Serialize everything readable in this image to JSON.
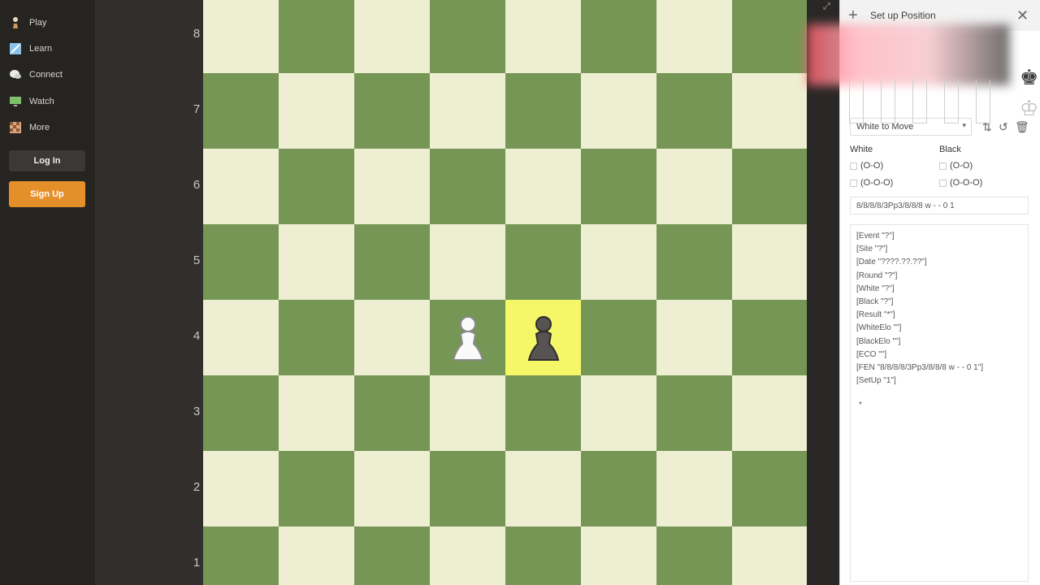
{
  "nav": {
    "items": [
      {
        "label": "Play",
        "icon": "pawn-icon"
      },
      {
        "label": "Learn",
        "icon": "puzzle-icon"
      },
      {
        "label": "Connect",
        "icon": "chat-icon"
      },
      {
        "label": "Watch",
        "icon": "monitor-icon"
      },
      {
        "label": "More",
        "icon": "grid-icon"
      }
    ],
    "login_label": "Log In",
    "signup_label": "Sign Up"
  },
  "board": {
    "ranks": [
      "8",
      "7",
      "6",
      "5",
      "4",
      "3",
      "2",
      "1"
    ],
    "colors": {
      "light": "#eeeed2",
      "dark": "#769656",
      "highlight": "#f6f669"
    },
    "pieces": [
      {
        "square": "d4",
        "piece": "white-pawn",
        "glyph": "♙"
      },
      {
        "square": "e4",
        "piece": "black-pawn",
        "glyph": "♟"
      }
    ],
    "highlighted_square": "e4"
  },
  "panel": {
    "title": "Set up Position",
    "side_to_move": "White to Move",
    "white_label": "White",
    "black_label": "Black",
    "white_options": [
      "(O-O)",
      "(O-O-O)"
    ],
    "black_options": [
      "(O-O)",
      "(O-O-O)"
    ],
    "fen": "8/8/8/8/3Pp3/8/8/8 w - - 0 1",
    "pgn": [
      "[Event \"?\"]",
      "[Site \"?\"]",
      "[Date \"????.??.??\"]",
      "[Round \"?\"]",
      "[White \"?\"]",
      "[Black \"?\"]",
      "[Result \"*\"]",
      "[WhiteElo \"\"]",
      "[BlackElo \"\"]",
      "[ECO \"\"]",
      "[FEN \"8/8/8/8/3Pp3/8/8/8 w - - 0 1\"]",
      "[SetUp \"1\"]"
    ],
    "result": "*"
  }
}
